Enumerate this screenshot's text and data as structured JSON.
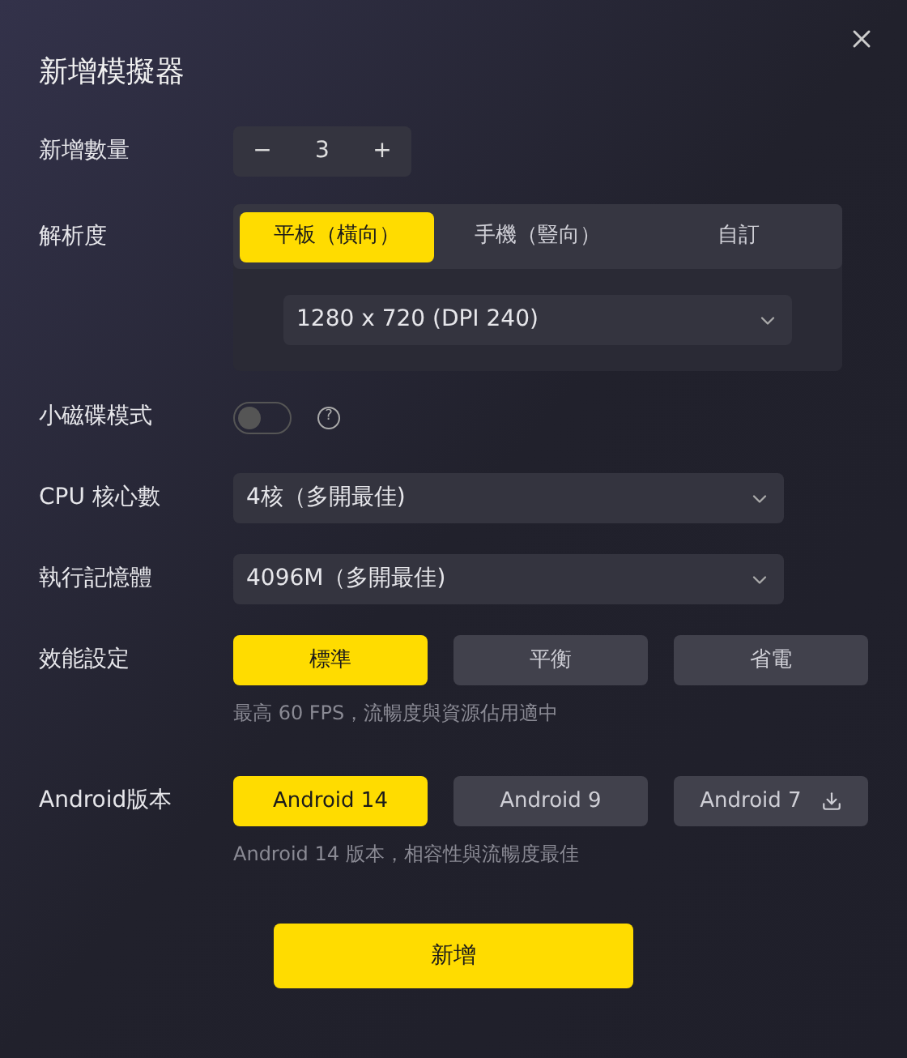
{
  "dialog": {
    "title": "新增模擬器"
  },
  "quantity": {
    "label": "新增數量",
    "minus": "−",
    "value": "3",
    "plus": "+"
  },
  "resolution": {
    "label": "解析度",
    "tabs": [
      {
        "label": "平板（橫向）",
        "selected": true
      },
      {
        "label": "手機（豎向）",
        "selected": false
      },
      {
        "label": "自訂",
        "selected": false
      }
    ],
    "dropdown": "1280 x 720 (DPI 240)"
  },
  "mini_disk": {
    "label": "小磁碟模式",
    "on": false,
    "help": "?"
  },
  "cpu": {
    "label": "CPU 核心數",
    "value": "4核（多開最佳)"
  },
  "memory": {
    "label": "執行記憶體",
    "value": "4096M（多開最佳)"
  },
  "performance": {
    "label": "效能設定",
    "options": [
      {
        "label": "標準",
        "selected": true
      },
      {
        "label": "平衡",
        "selected": false
      },
      {
        "label": "省電",
        "selected": false
      }
    ],
    "hint": "最高 60 FPS，流暢度與資源佔用適中"
  },
  "android": {
    "label": "Android版本",
    "options": [
      {
        "label": "Android 14",
        "selected": true,
        "download": false
      },
      {
        "label": "Android 9",
        "selected": false,
        "download": false
      },
      {
        "label": "Android 7",
        "selected": false,
        "download": true
      }
    ],
    "hint": "Android 14 版本，相容性與流暢度最佳"
  },
  "submit": "新增"
}
